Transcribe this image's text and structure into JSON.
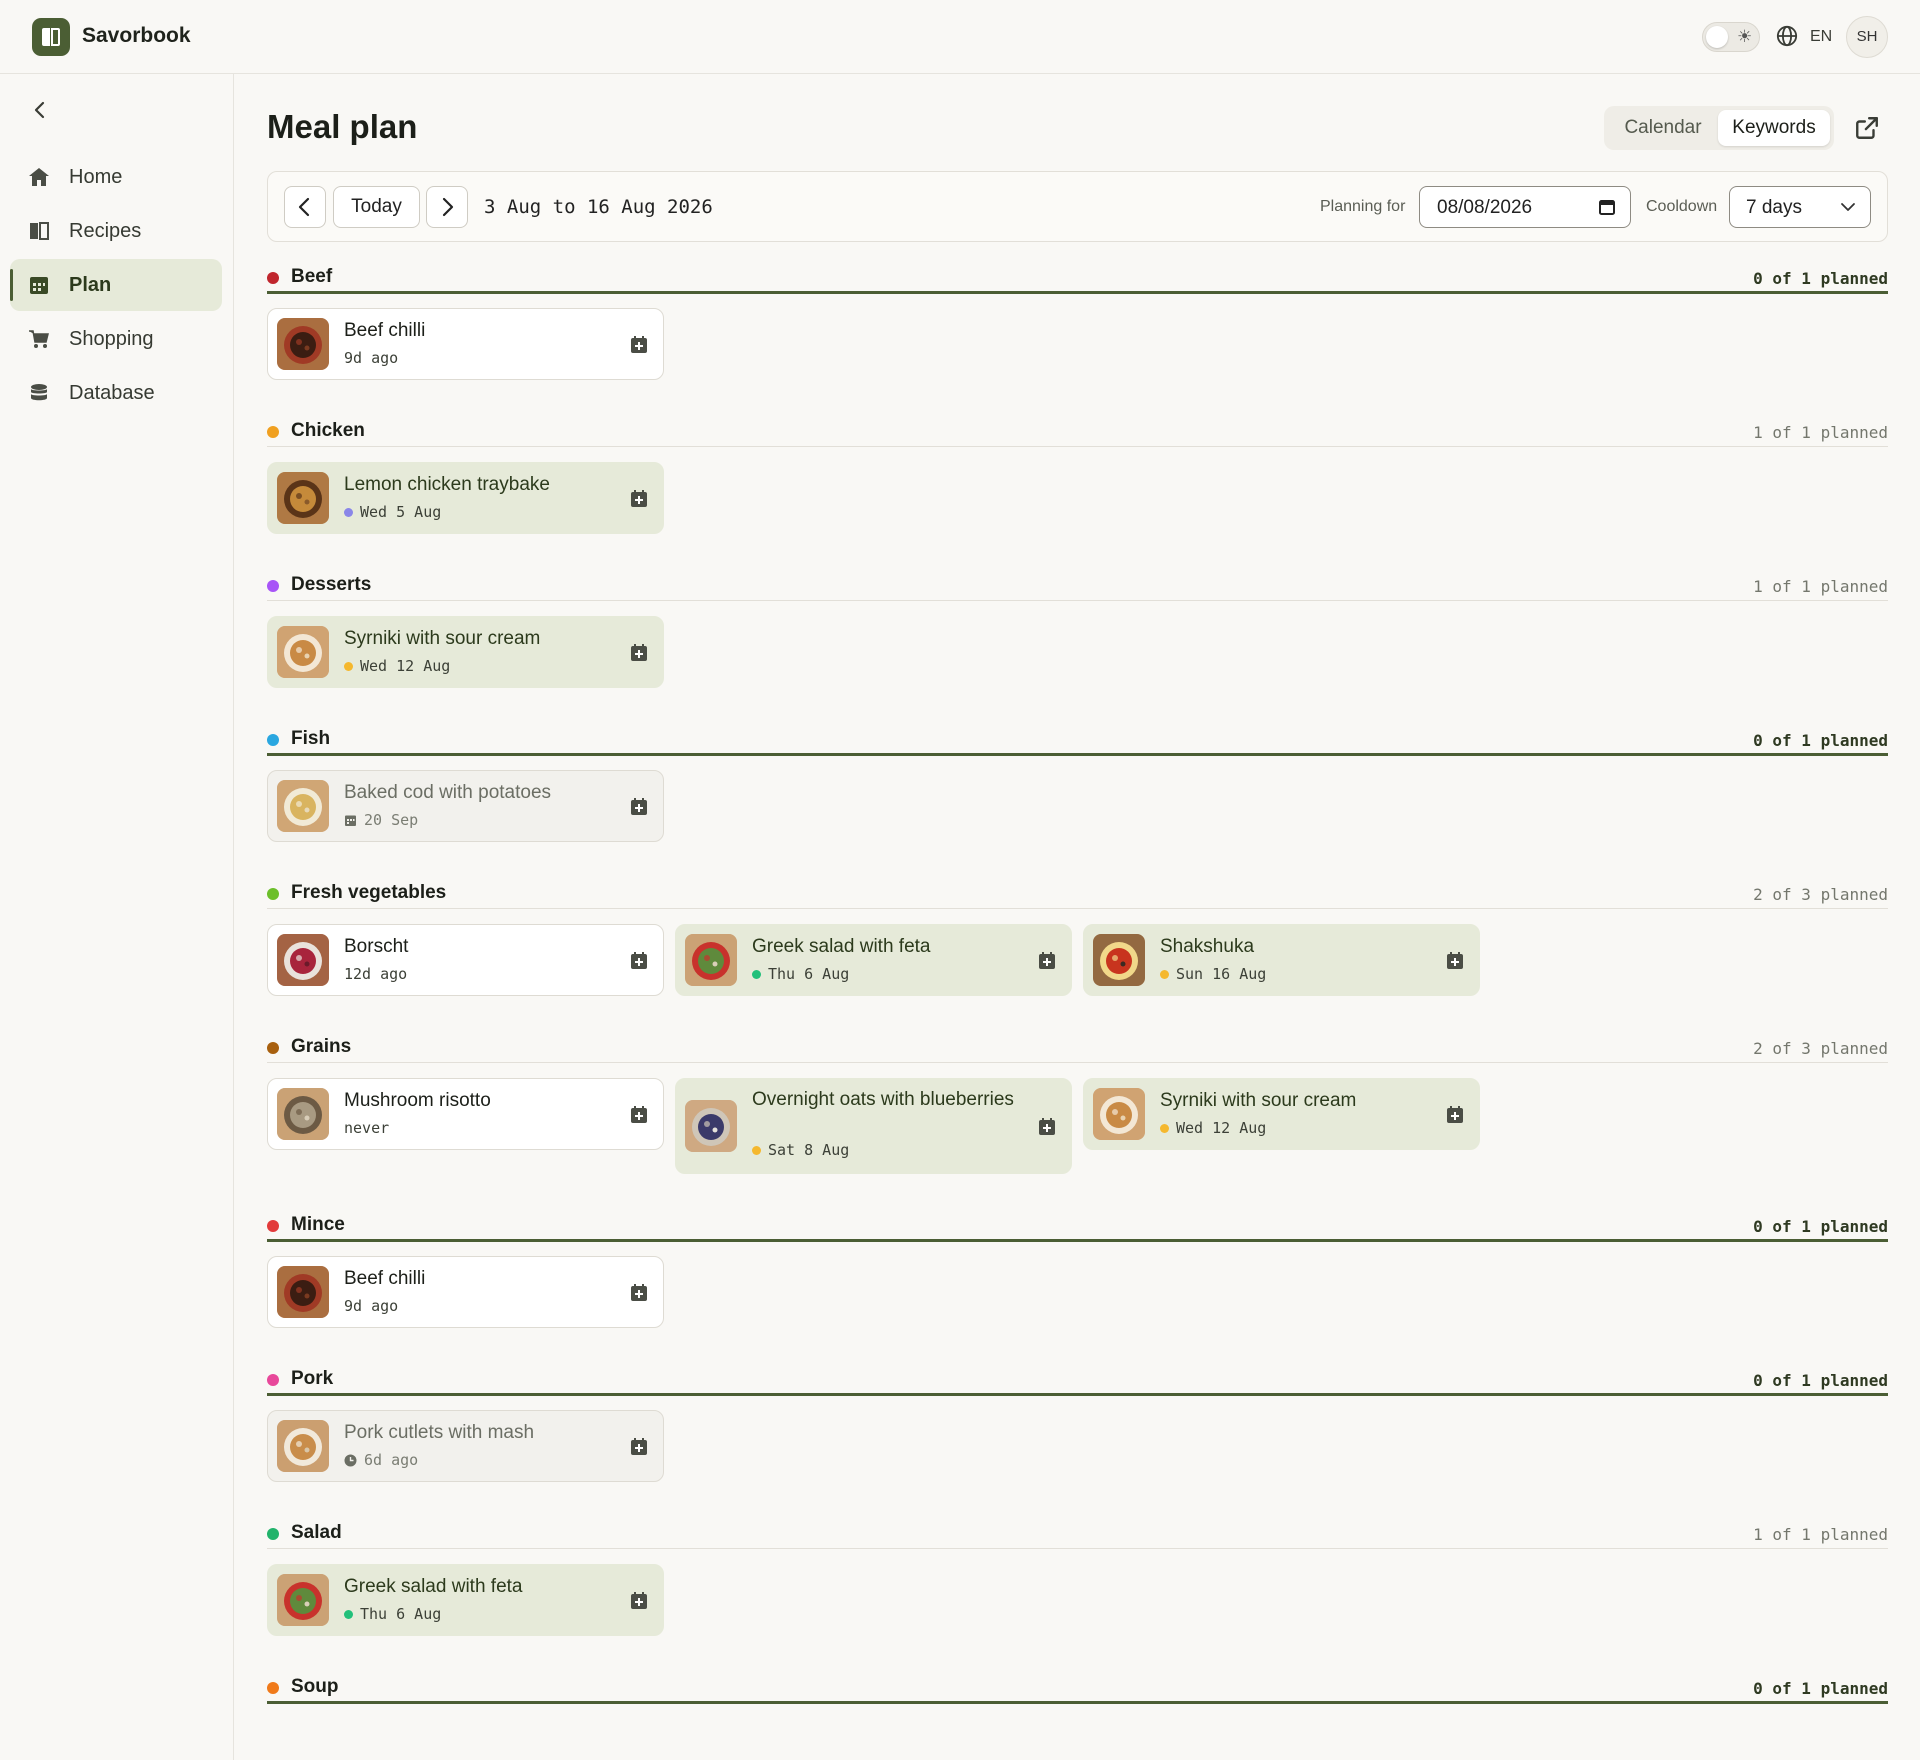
{
  "app": {
    "name": "Savorbook"
  },
  "header": {
    "lang": "EN",
    "avatar": "SH"
  },
  "nav": [
    {
      "label": "Home",
      "icon": "home-icon"
    },
    {
      "label": "Recipes",
      "icon": "book-icon"
    },
    {
      "label": "Plan",
      "icon": "calendar-icon",
      "active": true
    },
    {
      "label": "Shopping",
      "icon": "cart-icon"
    },
    {
      "label": "Database",
      "icon": "database-icon"
    }
  ],
  "page": {
    "title": "Meal plan"
  },
  "views": {
    "calendar": "Calendar",
    "keywords": "Keywords",
    "selected": "Keywords"
  },
  "toolbar": {
    "today": "Today",
    "range": "3 Aug to 16 Aug 2026",
    "planning_label": "Planning for",
    "planning_date": "08/08/2026",
    "cooldown_label": "Cooldown",
    "cooldown_value": "7 days"
  },
  "colors": {
    "accent": "#4b5e34",
    "planned_bg": "#e6ead9"
  },
  "sections": [
    {
      "name": "Beef",
      "color": "#c0262d",
      "count": "0 of 1 planned",
      "unmet": true,
      "cards": [
        {
          "name": "Beef chilli",
          "meta": "9d ago",
          "state": "normal",
          "food": "chilli"
        }
      ]
    },
    {
      "name": "Chicken",
      "color": "#f0a020",
      "count": "1 of 1 planned",
      "unmet": false,
      "cards": [
        {
          "name": "Lemon chicken traybake",
          "meta": "Wed 5 Aug",
          "state": "planned",
          "dot": "#8a86e8",
          "food": "tray"
        }
      ]
    },
    {
      "name": "Desserts",
      "color": "#a855f7",
      "count": "1 of 1 planned",
      "unmet": false,
      "cards": [
        {
          "name": "Syrniki with sour cream",
          "meta": "Wed 12 Aug",
          "state": "planned",
          "dot": "#f5b82e",
          "food": "syrniki"
        }
      ]
    },
    {
      "name": "Fish",
      "color": "#2aa7e0",
      "count": "0 of 1 planned",
      "unmet": true,
      "cards": [
        {
          "name": "Baked cod with potatoes",
          "meta": "20 Sep",
          "state": "muted",
          "metaIcon": "calendar-icon",
          "food": "cod"
        }
      ]
    },
    {
      "name": "Fresh vegetables",
      "color": "#6cbf2a",
      "count": "2 of 3 planned",
      "unmet": false,
      "cards": [
        {
          "name": "Borscht",
          "meta": "12d ago",
          "state": "normal",
          "food": "borscht"
        },
        {
          "name": "Greek salad with feta",
          "meta": "Thu 6 Aug",
          "state": "planned",
          "dot": "#22c07a",
          "food": "salad"
        },
        {
          "name": "Shakshuka",
          "meta": "Sun 16 Aug",
          "state": "planned",
          "dot": "#f5b82e",
          "food": "shakshuka"
        }
      ]
    },
    {
      "name": "Grains",
      "color": "#a8600e",
      "count": "2 of 3 planned",
      "unmet": false,
      "cards": [
        {
          "name": "Mushroom risotto",
          "meta": "never",
          "state": "normal",
          "food": "risotto"
        },
        {
          "name": "Overnight oats with blueberries",
          "meta": "Sat 8 Aug",
          "state": "planned",
          "dot": "#f5b82e",
          "food": "oats"
        },
        {
          "name": "Syrniki with sour cream",
          "meta": "Wed 12 Aug",
          "state": "planned",
          "dot": "#f5b82e",
          "food": "syrniki"
        }
      ]
    },
    {
      "name": "Mince",
      "color": "#e23b3b",
      "count": "0 of 1 planned",
      "unmet": true,
      "cards": [
        {
          "name": "Beef chilli",
          "meta": "9d ago",
          "state": "normal",
          "food": "chilli"
        }
      ]
    },
    {
      "name": "Pork",
      "color": "#e8489a",
      "count": "0 of 1 planned",
      "unmet": true,
      "cards": [
        {
          "name": "Pork cutlets with mash",
          "meta": "6d ago",
          "state": "muted",
          "metaIcon": "clock-icon",
          "food": "pork"
        }
      ]
    },
    {
      "name": "Salad",
      "color": "#22b36b",
      "count": "1 of 1 planned",
      "unmet": false,
      "cards": [
        {
          "name": "Greek salad with feta",
          "meta": "Thu 6 Aug",
          "state": "planned",
          "dot": "#22c07a",
          "food": "salad"
        }
      ]
    },
    {
      "name": "Soup",
      "color": "#f07a1a",
      "count": "0 of 1 planned",
      "unmet": true,
      "cards": []
    }
  ]
}
